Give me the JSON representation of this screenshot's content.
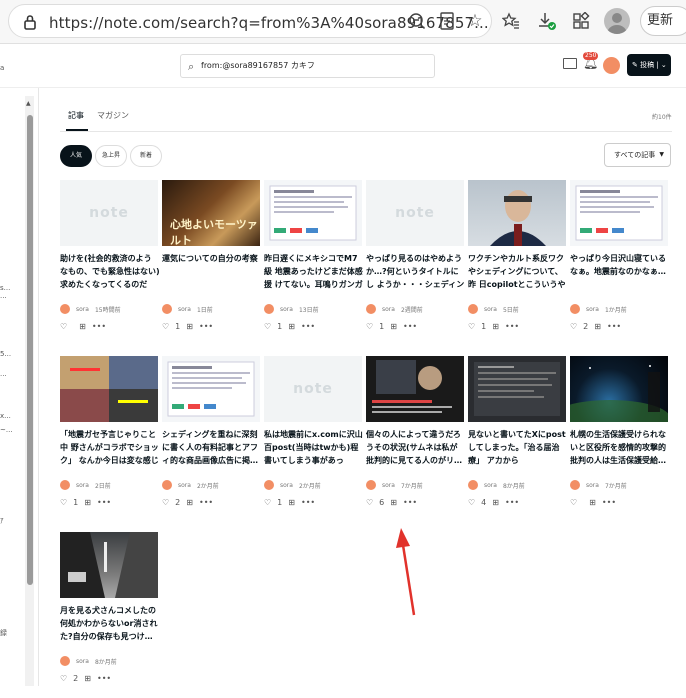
{
  "browser": {
    "url": "https://note.com/search?q=from%3A%40sora89167857...",
    "update_label": "更新"
  },
  "header": {
    "search_value": "from:@sora89167857 カキフ",
    "notification_count": "250",
    "post_label": "投稿"
  },
  "left_panel": {
    "fragments": [
      "a",
      "s...",
      "...",
      "5...",
      "...",
      "x...",
      "~...",
      "ｱ",
      "録"
    ]
  },
  "tabs": {
    "articles": "記事",
    "magazines": "マガジン",
    "count": "約10件"
  },
  "filters": {
    "popular": "人気",
    "rising": "急上昇",
    "newest": "新着",
    "sort": "すべての記事"
  },
  "colors": {
    "accent": "#08131a",
    "avatar": "#f28e64",
    "arrow": "#e1322b"
  },
  "cards": [
    {
      "title": "助けを(社会的救済のよう なもの、でも緊急性はない) 求めたくなってくるのだが…",
      "author": "sora",
      "time": "15時間前",
      "likes": "",
      "thumb_text": "note"
    },
    {
      "title": "運気についての自分の考察",
      "author": "sora",
      "time": "1日前",
      "likes": "1",
      "thumb_text": "心地よいモーツァルト"
    },
    {
      "title": "昨日遅くにメキシコでM7級 地震あったけどまだ体感援 けてない。耳鳴りガンガン…",
      "author": "sora",
      "time": "13日前",
      "likes": "1",
      "thumb_text": ""
    },
    {
      "title": "やっぱり見るのはやめよう か…?何というタイトルにし ようか・・・シェディング編…",
      "author": "sora",
      "time": "2週間前",
      "likes": "1",
      "thumb_text": "note"
    },
    {
      "title": "ワクチンやカルト系反ワク やシェディングについて、昨 日copilotとこういうやり…",
      "author": "sora",
      "time": "5日前",
      "likes": "1",
      "thumb_text": ""
    },
    {
      "title": "やっぱり今日沢山寝ている なぁ。地震前なのかなぁ…",
      "author": "sora",
      "time": "1か月前",
      "likes": "2",
      "thumb_text": ""
    },
    {
      "title": "「地震ガセ予言じゃりこと中 野さんがコラボでショック」 なんか今日は変な感じだ…",
      "author": "sora",
      "time": "2日前",
      "likes": "1",
      "thumb_text": ""
    },
    {
      "title": "シェディングを重ねに深刻 に書く人の有料記事とアフ ィ的な商品画像広告に掲…",
      "author": "sora",
      "time": "2か月前",
      "likes": "2",
      "thumb_text": ""
    },
    {
      "title": "私は地震前にx.comに沢山 百post(当時はtwかも)程 書いてしまう事があった。…",
      "author": "sora",
      "time": "2か月前",
      "likes": "1",
      "thumb_text": "note"
    },
    {
      "title": "個々の人によって違うだろ うその状況(サムネは私が 批判的に見てる人のがリ…",
      "author": "sora",
      "time": "7か月前",
      "likes": "6",
      "thumb_text": ""
    },
    {
      "title": "見ないと書いてたXにpost してしまった。「治る届治療」 アカから",
      "author": "sora",
      "time": "8か月前",
      "likes": "4",
      "thumb_text": ""
    },
    {
      "title": "札幌の生活保護受けられな いと区役所を感情的攻撃的 批判の人は生活保護受給…",
      "author": "sora",
      "time": "7か月前",
      "likes": "",
      "thumb_text": ""
    },
    {
      "title": "月を見る犬さんコメしたの 何処かわからないor消され た?自分の保存も見つけ…",
      "author": "sora",
      "time": "8か月前",
      "likes": "2",
      "thumb_text": ""
    }
  ]
}
